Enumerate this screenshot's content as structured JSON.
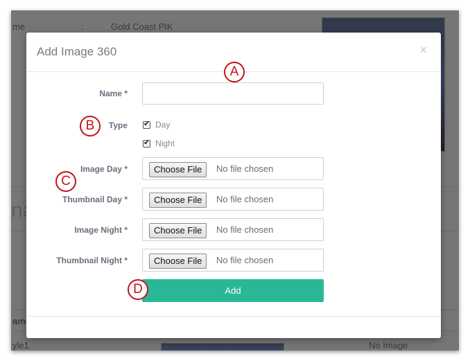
{
  "background": {
    "top_field_label": "me",
    "top_field_sep": ":",
    "top_field_value": "Gold Coast PIK",
    "heading_partial": "na",
    "table_header_partial": "ame",
    "row_name_partial": "yle1",
    "row_image_status": "No Image"
  },
  "modal": {
    "title": "Add Image 360",
    "close_label": "×",
    "fields": {
      "name_label": "Name *",
      "name_value": "",
      "type_label": "Type",
      "type_options": [
        {
          "label": "Day",
          "checked": true
        },
        {
          "label": "Night",
          "checked": true
        }
      ],
      "files": [
        {
          "label": "Image Day *",
          "button": "Choose File",
          "status": "No file chosen"
        },
        {
          "label": "Thumbnail Day *",
          "button": "Choose File",
          "status": "No file chosen"
        },
        {
          "label": "Image Night *",
          "button": "Choose File",
          "status": "No file chosen"
        },
        {
          "label": "Thumbnail Night *",
          "button": "Choose File",
          "status": "No file chosen"
        }
      ]
    },
    "submit_label": "Add"
  },
  "annotations": [
    "A",
    "B",
    "C",
    "D"
  ],
  "colors": {
    "accent_button": "#29b896",
    "annotation_red": "#c0141a",
    "overlay": "#767676"
  }
}
